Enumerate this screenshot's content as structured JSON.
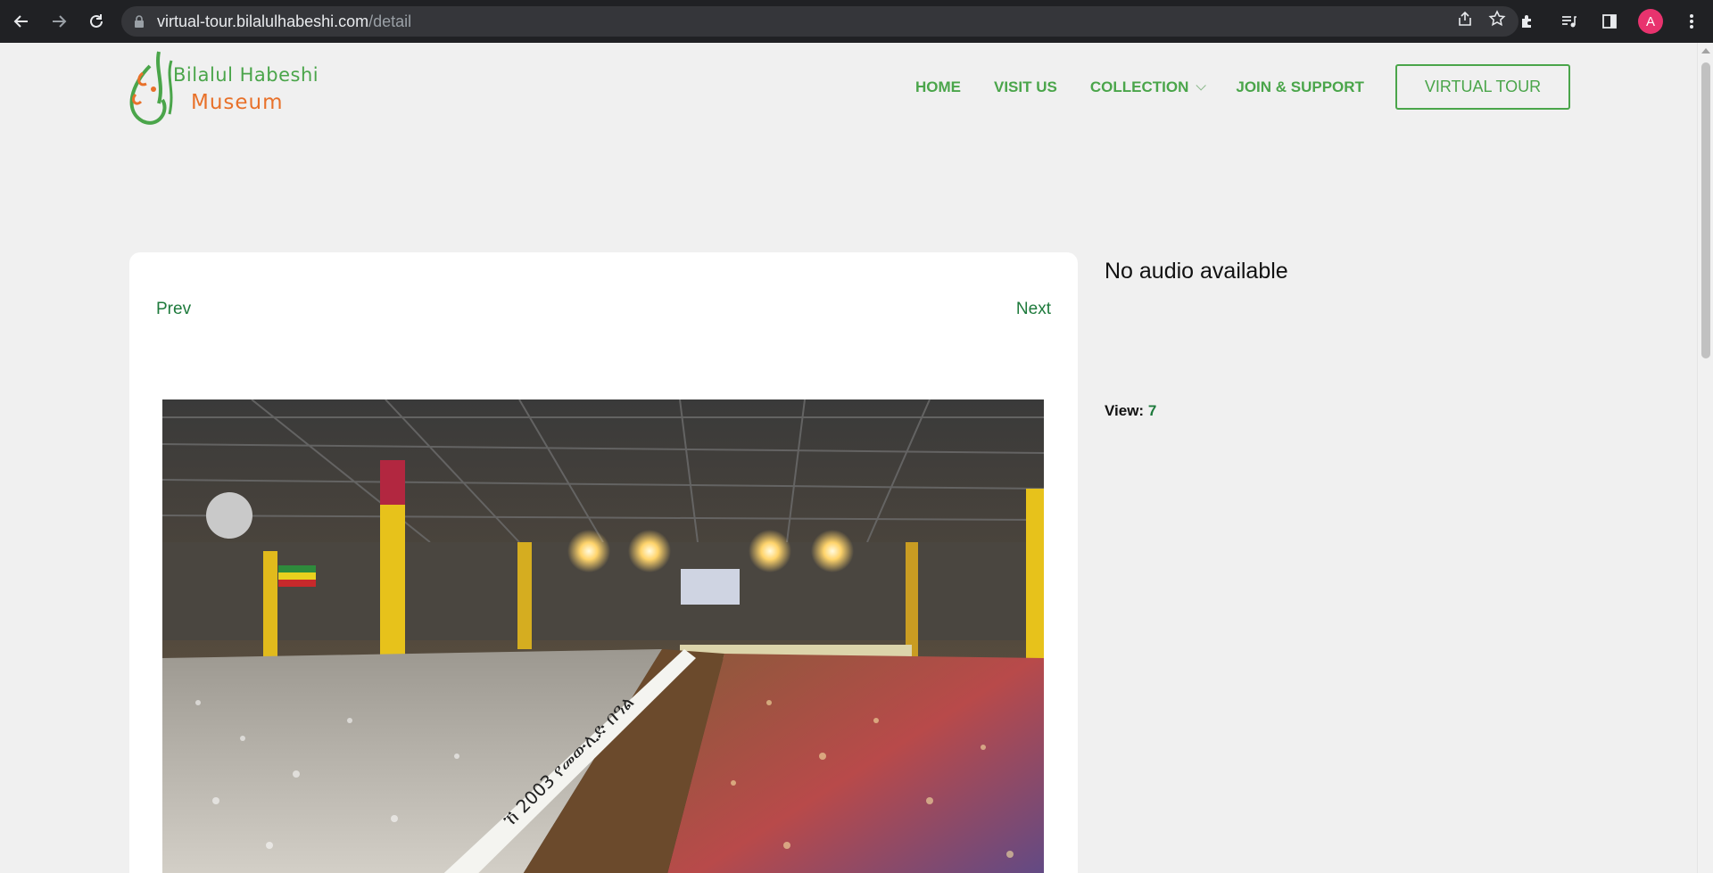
{
  "browser": {
    "url_domain": "virtual-tour.bilalulhabeshi.com",
    "url_path": "/detail",
    "profile_initial": "A",
    "icons": [
      "back-arrow-icon",
      "forward-arrow-icon",
      "reload-icon",
      "lock-icon",
      "share-icon",
      "star-icon",
      "extensions-icon",
      "media-icon",
      "sidepanel-icon",
      "menu-kebab-icon"
    ]
  },
  "site": {
    "logo_line1": "Bilalul Habeshi",
    "logo_line2": "Museum",
    "nav": {
      "home": "HOME",
      "visit": "VISIT US",
      "collection": "COLLECTION",
      "join": "JOIN & SUPPORT",
      "virtual_tour": "VIRTUAL TOUR"
    },
    "colors": {
      "accent": "#4aa54a",
      "link": "#1e7a3c",
      "logo_orange": "#e8712a"
    }
  },
  "detail": {
    "prev": "Prev",
    "next": "Next",
    "no_audio": "No audio available",
    "views_label": "View:",
    "views_count": "7",
    "banner_text": "ኸ 2003 የመውሊድ በዓል"
  }
}
